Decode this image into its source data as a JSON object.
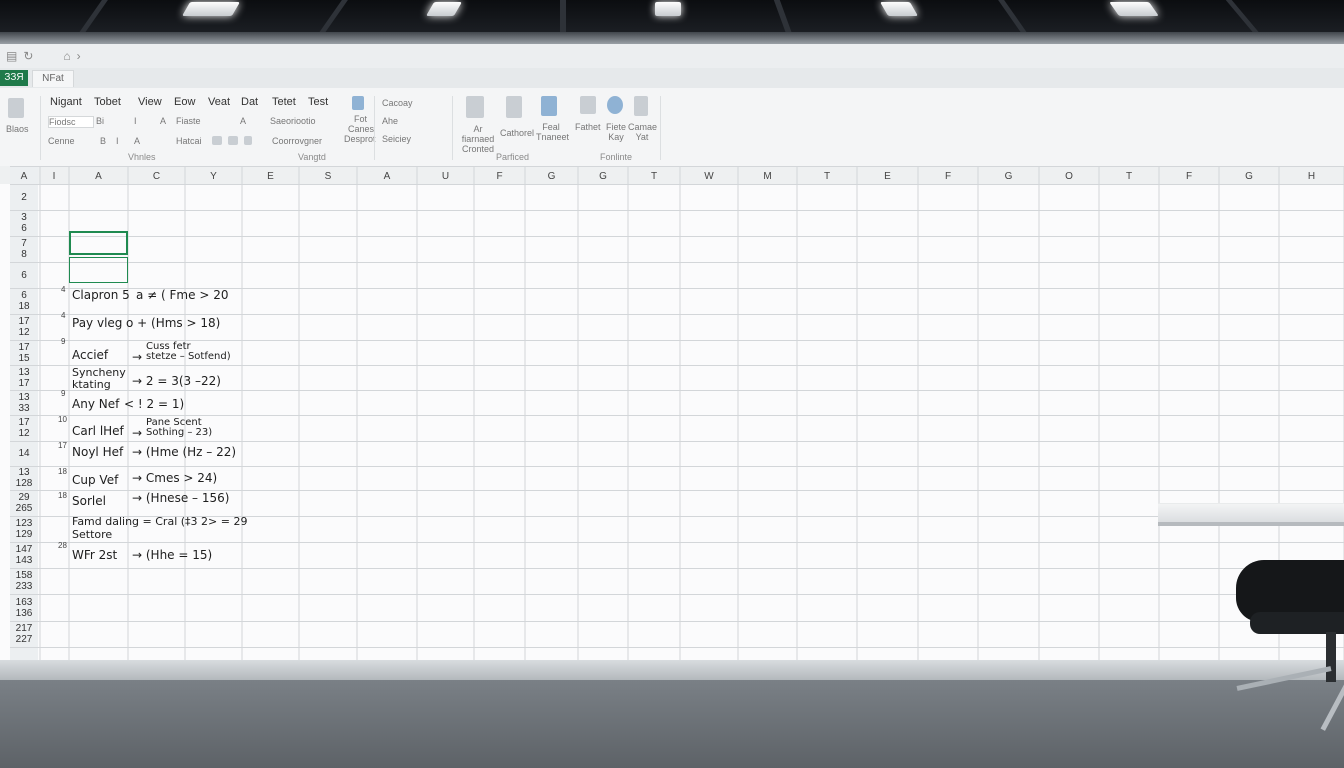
{
  "window": {
    "title_icons": [
      "▤",
      "↻",
      "⌂",
      "›"
    ],
    "tabs": [
      {
        "label": "ЗЗЯ",
        "active": true
      },
      {
        "label": "NFat",
        "active": false
      }
    ]
  },
  "ribbon": {
    "tabs": [
      "Nigant",
      "Tobet",
      "View",
      "Eow",
      "Veat",
      "Dat",
      "Tetet",
      "Test"
    ],
    "left_label": "Blaos",
    "font_row": [
      "Fiodsc",
      "Bi",
      "I",
      "A",
      "Fiaste",
      "A"
    ],
    "format_row": [
      "Cenne",
      "B",
      "I",
      "A",
      "Hatcai"
    ],
    "cells_row": [
      "Saeoriootio",
      "Coorrovgner"
    ],
    "cond_label": [
      "Fot",
      "Canes",
      "Desprot"
    ],
    "styles_row": [
      "Cacoay",
      "Ahe",
      "Seiciey"
    ],
    "insert_labels": [
      "Ar fiarnaed Cronted",
      "Cathorel",
      "Feal Tnaneet",
      "Fathet",
      "Fiete Kay",
      "Camae Yat"
    ],
    "groups": [
      "Vhnles",
      "Vangtd",
      "Parficed",
      "Fonlinte"
    ]
  },
  "sheet": {
    "corner_label": "A",
    "first_col": "I",
    "columns": [
      "A",
      "C",
      "Y",
      "E",
      "S",
      "A",
      "U",
      "F",
      "G",
      "G",
      "T",
      "W",
      "M",
      "T",
      "E",
      "F",
      "G",
      "O",
      "T",
      "F",
      "G",
      "H"
    ],
    "row_labels": [
      "2",
      "3\n6",
      "7\n8",
      "6",
      "6\n18",
      "17\n12",
      "17\n15",
      "13\n17",
      "13\n33",
      "17\n12",
      "14",
      "13\n128",
      "29\n265",
      "123\n129",
      "147\n143",
      "158\n233",
      "163\n136",
      "217\n227"
    ],
    "rows": [
      {
        "marker": "4",
        "label": "Clapron 5",
        "formula": "a ≠ ( Fme > 20"
      },
      {
        "marker": "4",
        "label": "Pay vleg",
        "formula": "o + (Hms > 18)"
      },
      {
        "marker": "9",
        "label": "Accief",
        "formula_small": "Cuss fetr\nstetze – Sotfend)",
        "arrow": "→"
      },
      {
        "marker": "",
        "label": "Syncheny\nktating",
        "formula": "→ 2 = 3(3 –22)"
      },
      {
        "marker": "9",
        "label": "Any Nef",
        "formula": "< ! 2 = 1)"
      },
      {
        "marker": "10",
        "label": "Carl lHef",
        "formula_small": "Pane Scent\nSothing – 23)",
        "arrow": "→"
      },
      {
        "marker": "17",
        "label": "Noyl Hef",
        "formula": "→ (Hme (Hz – 22)"
      },
      {
        "marker": "18",
        "label": "Cup Vef",
        "formula": "→ Cmes > 24)"
      },
      {
        "marker": "18",
        "label": "Sorlel",
        "formula": "→ (Hnese – 156)"
      },
      {
        "marker": "",
        "label": "Famd daling = Cral (‡3 2> = 29\nSettore",
        "formula": ""
      },
      {
        "marker": "28",
        "label": "WFr 2st",
        "formula": "→ (Hhe = 15)"
      }
    ]
  }
}
